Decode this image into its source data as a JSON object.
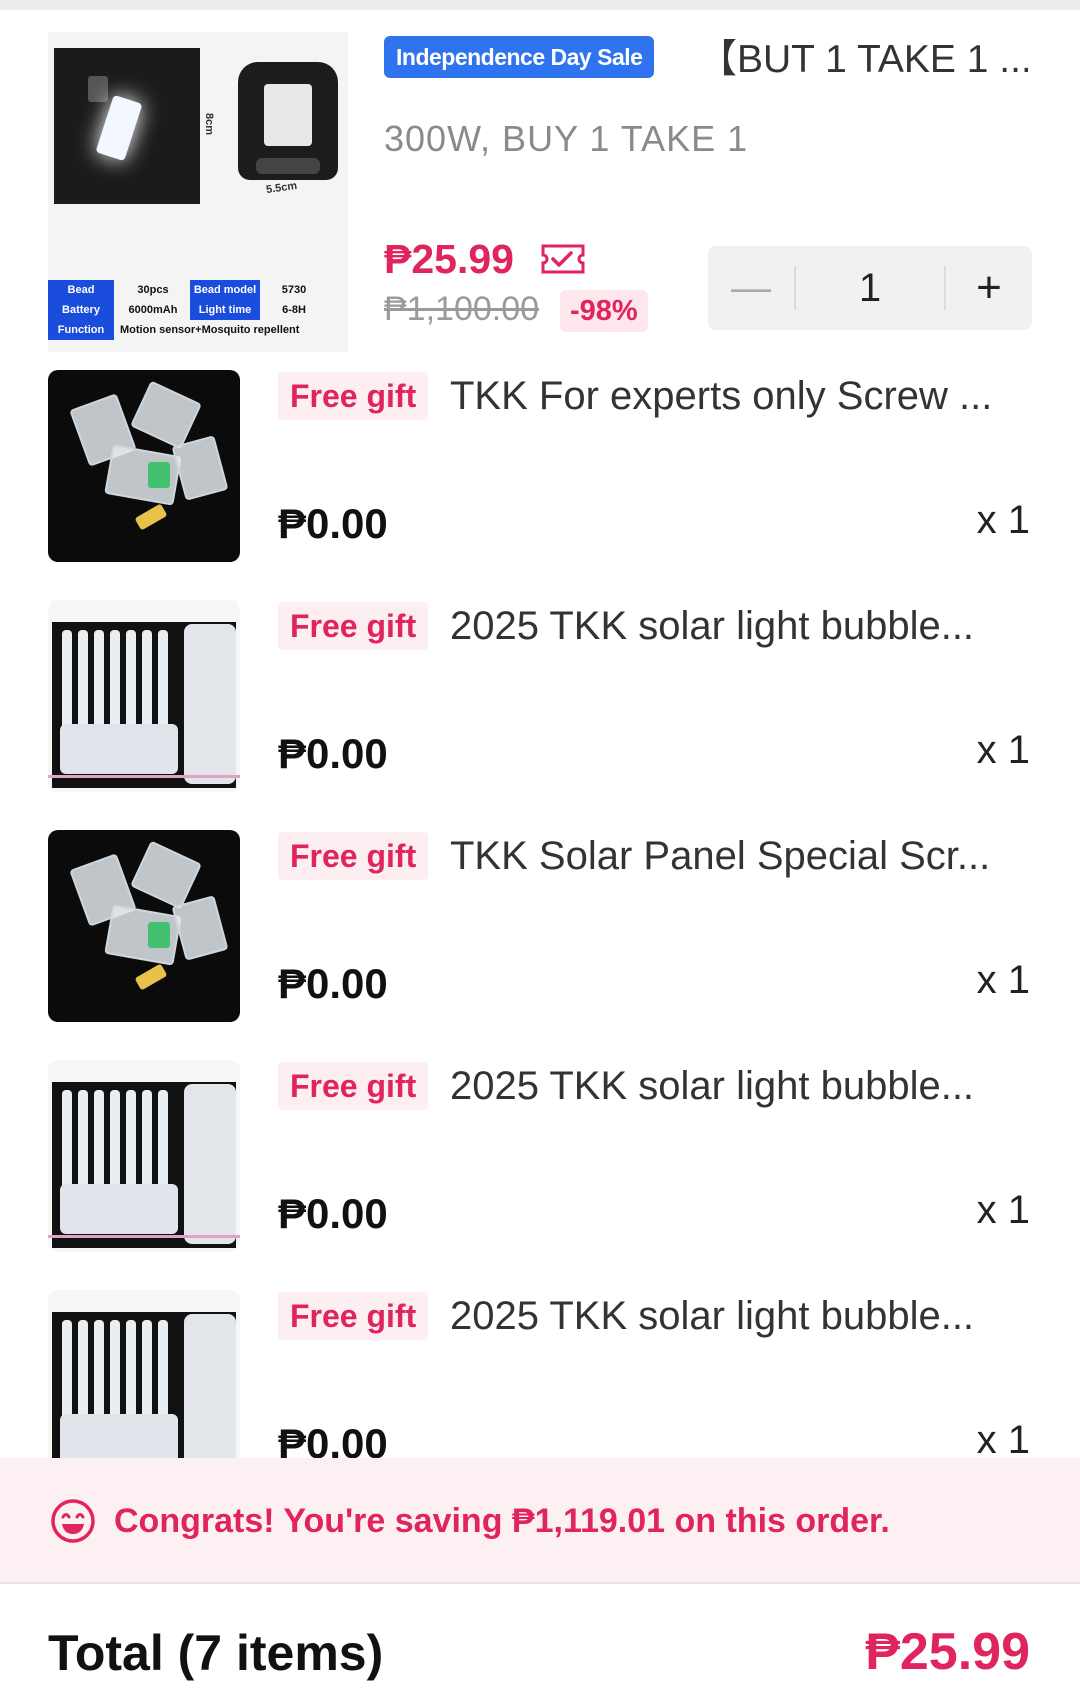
{
  "main_item": {
    "image_alt": "solar lamp product image",
    "image_specs": {
      "dim_height": "8cm",
      "dim_width": "5.5cm",
      "labels": [
        "Bead",
        "30pcs",
        "Bead model",
        "5730",
        "Battery",
        "6000mAh",
        "Light time",
        "6-8H",
        "Function",
        "Motion sensor+Mosquito repellent"
      ]
    },
    "sale_badge": "Independence Day Sale",
    "title": "【BUT 1 TAKE 1 ...",
    "variant": "300W, BUY 1 TAKE 1",
    "price": "₱25.99",
    "original_price": "₱1,100.00",
    "discount": "-98%",
    "quantity": "1",
    "minus_symbol": "—",
    "plus_symbol": "+"
  },
  "gifts": [
    {
      "badge": "Free gift",
      "title": "TKK For experts only Screw ...",
      "price": "₱0.00",
      "qty": "x 1",
      "thumb": "screws"
    },
    {
      "badge": "Free gift",
      "title": "2025 TKK solar light bubble...",
      "price": "₱0.00",
      "qty": "x 1",
      "thumb": "bubble"
    },
    {
      "badge": "Free gift",
      "title": "TKK Solar Panel Special Scr...",
      "price": "₱0.00",
      "qty": "x 1",
      "thumb": "screws"
    },
    {
      "badge": "Free gift",
      "title": "2025 TKK solar light bubble...",
      "price": "₱0.00",
      "qty": "x 1",
      "thumb": "bubble"
    },
    {
      "badge": "Free gift",
      "title": "2025 TKK solar light bubble...",
      "price": "₱0.00",
      "qty": "x 1",
      "thumb": "bubble"
    }
  ],
  "savings": {
    "icon": "smile-icon",
    "text": "Congrats! You're saving ₱1,119.01 on this order."
  },
  "total": {
    "label": "Total (7 items)",
    "value": "₱25.99"
  },
  "colors": {
    "accent": "#e0245e",
    "sale_blue": "#2f74ee",
    "savings_bg": "#fdf0f3"
  }
}
